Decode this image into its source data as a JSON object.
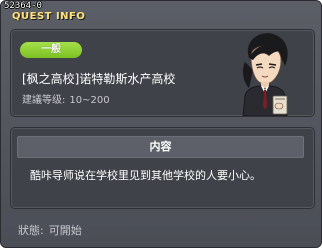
{
  "window": {
    "quest_id": "52364-0",
    "title": "QUEST INFO"
  },
  "quest": {
    "badge": "一般",
    "name": "[枫之高校]诺特勒斯水产高校",
    "level_label": "建議等级:",
    "level_value": "10~200"
  },
  "npc": {
    "icon": "teacher-npc-portrait"
  },
  "content": {
    "header": "内容",
    "description": "酷咔导师说在学校里见到其他学校的人要小心。"
  },
  "status": {
    "label": "狀態:",
    "value": "可開始"
  },
  "colors": {
    "title": "#ffe27a",
    "badge": "#8ccf2e",
    "panel": "#3f4248",
    "window": "#53565e"
  }
}
